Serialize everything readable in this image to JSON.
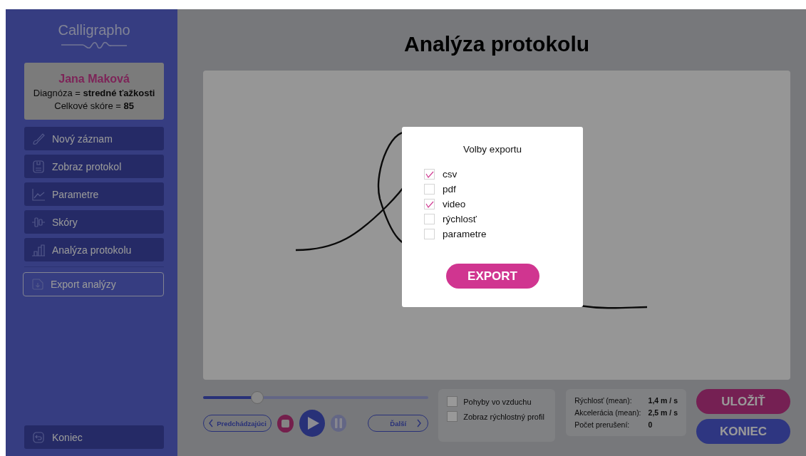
{
  "sidebar": {
    "logo": "Calligrapho",
    "profile": {
      "name": "Jana Maková",
      "diagnosis": "Diagnóza = **stredné ťažkosti**",
      "score": "Celkové skóre = **85**"
    },
    "items": [
      {
        "label": "Nový záznam",
        "kind": "brush"
      },
      {
        "label": "Zobraz protokol",
        "kind": "doc"
      },
      {
        "label": "Parametre",
        "kind": "chart"
      },
      {
        "label": "Skóry",
        "kind": "scores"
      },
      {
        "label": "Analýza protokolu",
        "kind": "bars"
      }
    ],
    "export": {
      "label": "Export analýzy"
    },
    "exit": {
      "label": "Koniec"
    }
  },
  "title": "Analýza protokolu",
  "player": {
    "level": 0.24,
    "previous": "Predchádzajúci",
    "next": "Ďalší"
  },
  "options": [
    {
      "label": "Pohyby vo vzduchu",
      "checked": false
    },
    {
      "label": "Zobraz rýchlostný profil",
      "checked": false
    }
  ],
  "stats": [
    {
      "label": "Rýchlosť (mean):",
      "value": "1,4 m / s"
    },
    {
      "label": "Akcelerácia (mean):",
      "value": "2,5 m / s"
    },
    {
      "label": "Počet prerušení:",
      "value": "0"
    }
  ],
  "actions": {
    "save": "ULOŽIŤ",
    "end": "KONIEC"
  },
  "dialog": {
    "title": "Volby exportu",
    "options": [
      {
        "label": "csv",
        "checked": true
      },
      {
        "label": "pdf",
        "checked": false
      },
      {
        "label": "video",
        "checked": true
      },
      {
        "label": "rýchlosť",
        "checked": false
      },
      {
        "label": "parametre",
        "checked": false
      }
    ],
    "button": "EXPORT"
  }
}
